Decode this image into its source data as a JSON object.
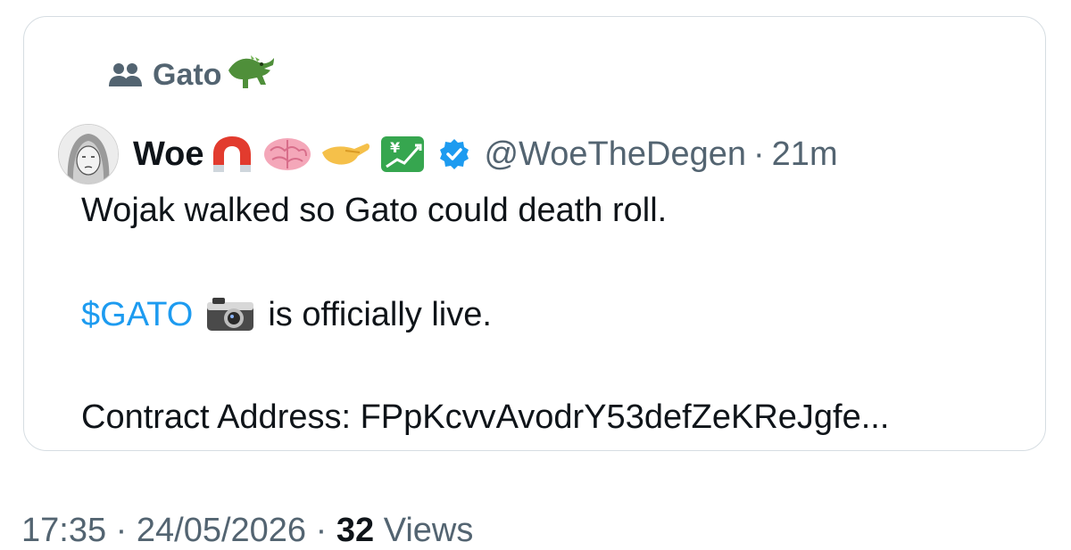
{
  "quote": {
    "community": "Gato",
    "display_name": "Woe",
    "handle": "@WoeTheDegen",
    "separator": "·",
    "time": "21m",
    "lines": {
      "first": "Wojak walked so Gato could death roll.",
      "cashtag": "$GATO",
      "second_rest": "is officially live.",
      "third": "Contract Address: FPpKcvvAvodrY53defZeKReJgfe..."
    }
  },
  "meta": {
    "time": "17:35",
    "sep1": "·",
    "date": "24/05/2026",
    "sep2": "·",
    "views_count": "32",
    "views_label": "Views"
  },
  "icons": {
    "community": "people-icon",
    "community_emoji": "crocodile-icon",
    "name_emojis": [
      "magnet-icon",
      "brain-icon",
      "pinching-hand-icon",
      "yen-chart-icon"
    ],
    "verified": "verified-badge-icon",
    "inline": "camera-icon"
  },
  "colors": {
    "link": "#1d9bf0",
    "secondary": "#536471",
    "text": "#0f1419",
    "border": "#d6dde2",
    "verified": "#1d9bf0"
  }
}
